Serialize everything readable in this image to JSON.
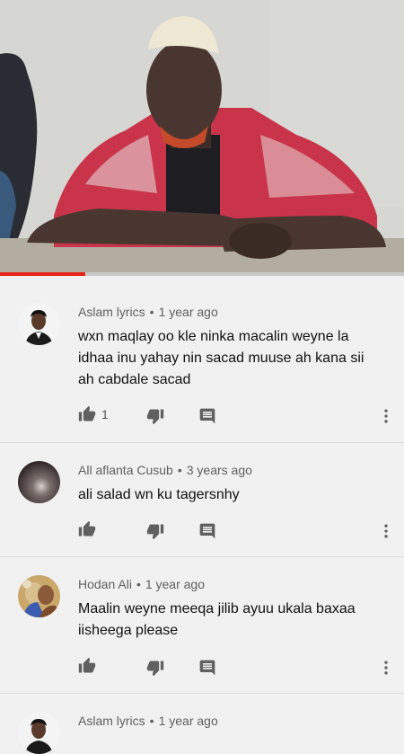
{
  "video": {
    "progress": 0.21
  },
  "comments": [
    {
      "author": "Aslam lyrics",
      "separator": "•",
      "time": "1 year ago",
      "text": "wxn maqlay oo kle ninka macalin weyne la idhaa inu yahay nin sacad muuse ah kana sii ah cabdale sacad",
      "likes": "1"
    },
    {
      "author": "All aflanta Cusub",
      "separator": "•",
      "time": "3 years ago",
      "text": "ali salad wn ku tagersnhy",
      "likes": ""
    },
    {
      "author": "Hodan Ali",
      "separator": "•",
      "time": "1 year ago",
      "text": "Maalin weyne meeqa jilib ayuu ukala baxaa iisheega please",
      "likes": ""
    },
    {
      "author": "Aslam lyrics",
      "separator": "•",
      "time": "1 year ago",
      "text": "",
      "likes": ""
    }
  ],
  "icons": {
    "like": "thumb-up-icon",
    "dislike": "thumb-down-icon",
    "reply": "reply-icon",
    "more": "more-vert-icon"
  },
  "colors": {
    "progress": "#e62117",
    "icon": "#606060",
    "background": "#f1f1f1"
  }
}
